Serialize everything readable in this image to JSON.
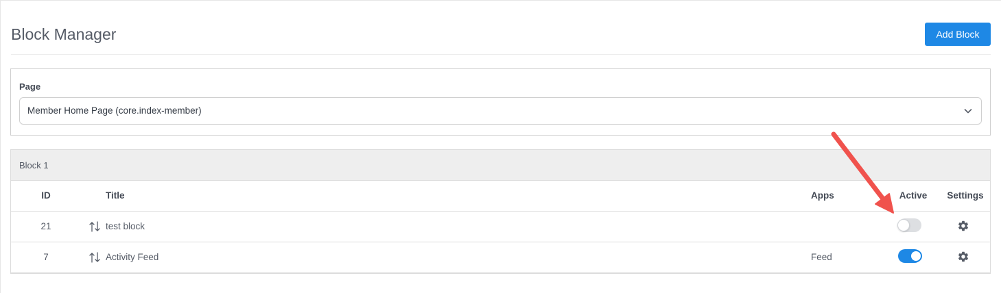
{
  "header": {
    "title": "Block Manager",
    "add_block_label": "Add Block"
  },
  "page_selector": {
    "label": "Page",
    "selected": "Member Home Page (core.index-member)"
  },
  "block": {
    "name": "Block 1",
    "columns": {
      "id": "ID",
      "title": "Title",
      "apps": "Apps",
      "active": "Active",
      "settings": "Settings"
    },
    "rows": [
      {
        "id": "21",
        "title": "test block",
        "apps": "",
        "active": false
      },
      {
        "id": "7",
        "title": "Activity Feed",
        "apps": "Feed",
        "active": true
      }
    ]
  },
  "colors": {
    "primary": "#1e88e5",
    "annotation_arrow": "#f0524d",
    "block_header_bg": "#eeeeee"
  },
  "icons": {
    "select_caret": "chevron-down-icon",
    "row_reorder": "sort-arrows-icon",
    "row_settings": "gear-icon"
  }
}
